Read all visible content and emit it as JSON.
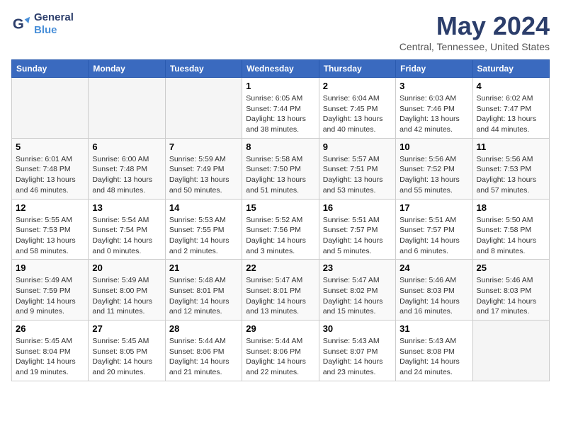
{
  "logo": {
    "line1": "General",
    "line2": "Blue"
  },
  "title": "May 2024",
  "location": "Central, Tennessee, United States",
  "weekdays": [
    "Sunday",
    "Monday",
    "Tuesday",
    "Wednesday",
    "Thursday",
    "Friday",
    "Saturday"
  ],
  "weeks": [
    [
      {
        "day": "",
        "sunrise": "",
        "sunset": "",
        "daylight": ""
      },
      {
        "day": "",
        "sunrise": "",
        "sunset": "",
        "daylight": ""
      },
      {
        "day": "",
        "sunrise": "",
        "sunset": "",
        "daylight": ""
      },
      {
        "day": "1",
        "sunrise": "Sunrise: 6:05 AM",
        "sunset": "Sunset: 7:44 PM",
        "daylight": "Daylight: 13 hours and 38 minutes."
      },
      {
        "day": "2",
        "sunrise": "Sunrise: 6:04 AM",
        "sunset": "Sunset: 7:45 PM",
        "daylight": "Daylight: 13 hours and 40 minutes."
      },
      {
        "day": "3",
        "sunrise": "Sunrise: 6:03 AM",
        "sunset": "Sunset: 7:46 PM",
        "daylight": "Daylight: 13 hours and 42 minutes."
      },
      {
        "day": "4",
        "sunrise": "Sunrise: 6:02 AM",
        "sunset": "Sunset: 7:47 PM",
        "daylight": "Daylight: 13 hours and 44 minutes."
      }
    ],
    [
      {
        "day": "5",
        "sunrise": "Sunrise: 6:01 AM",
        "sunset": "Sunset: 7:48 PM",
        "daylight": "Daylight: 13 hours and 46 minutes."
      },
      {
        "day": "6",
        "sunrise": "Sunrise: 6:00 AM",
        "sunset": "Sunset: 7:48 PM",
        "daylight": "Daylight: 13 hours and 48 minutes."
      },
      {
        "day": "7",
        "sunrise": "Sunrise: 5:59 AM",
        "sunset": "Sunset: 7:49 PM",
        "daylight": "Daylight: 13 hours and 50 minutes."
      },
      {
        "day": "8",
        "sunrise": "Sunrise: 5:58 AM",
        "sunset": "Sunset: 7:50 PM",
        "daylight": "Daylight: 13 hours and 51 minutes."
      },
      {
        "day": "9",
        "sunrise": "Sunrise: 5:57 AM",
        "sunset": "Sunset: 7:51 PM",
        "daylight": "Daylight: 13 hours and 53 minutes."
      },
      {
        "day": "10",
        "sunrise": "Sunrise: 5:56 AM",
        "sunset": "Sunset: 7:52 PM",
        "daylight": "Daylight: 13 hours and 55 minutes."
      },
      {
        "day": "11",
        "sunrise": "Sunrise: 5:56 AM",
        "sunset": "Sunset: 7:53 PM",
        "daylight": "Daylight: 13 hours and 57 minutes."
      }
    ],
    [
      {
        "day": "12",
        "sunrise": "Sunrise: 5:55 AM",
        "sunset": "Sunset: 7:53 PM",
        "daylight": "Daylight: 13 hours and 58 minutes."
      },
      {
        "day": "13",
        "sunrise": "Sunrise: 5:54 AM",
        "sunset": "Sunset: 7:54 PM",
        "daylight": "Daylight: 14 hours and 0 minutes."
      },
      {
        "day": "14",
        "sunrise": "Sunrise: 5:53 AM",
        "sunset": "Sunset: 7:55 PM",
        "daylight": "Daylight: 14 hours and 2 minutes."
      },
      {
        "day": "15",
        "sunrise": "Sunrise: 5:52 AM",
        "sunset": "Sunset: 7:56 PM",
        "daylight": "Daylight: 14 hours and 3 minutes."
      },
      {
        "day": "16",
        "sunrise": "Sunrise: 5:51 AM",
        "sunset": "Sunset: 7:57 PM",
        "daylight": "Daylight: 14 hours and 5 minutes."
      },
      {
        "day": "17",
        "sunrise": "Sunrise: 5:51 AM",
        "sunset": "Sunset: 7:57 PM",
        "daylight": "Daylight: 14 hours and 6 minutes."
      },
      {
        "day": "18",
        "sunrise": "Sunrise: 5:50 AM",
        "sunset": "Sunset: 7:58 PM",
        "daylight": "Daylight: 14 hours and 8 minutes."
      }
    ],
    [
      {
        "day": "19",
        "sunrise": "Sunrise: 5:49 AM",
        "sunset": "Sunset: 7:59 PM",
        "daylight": "Daylight: 14 hours and 9 minutes."
      },
      {
        "day": "20",
        "sunrise": "Sunrise: 5:49 AM",
        "sunset": "Sunset: 8:00 PM",
        "daylight": "Daylight: 14 hours and 11 minutes."
      },
      {
        "day": "21",
        "sunrise": "Sunrise: 5:48 AM",
        "sunset": "Sunset: 8:01 PM",
        "daylight": "Daylight: 14 hours and 12 minutes."
      },
      {
        "day": "22",
        "sunrise": "Sunrise: 5:47 AM",
        "sunset": "Sunset: 8:01 PM",
        "daylight": "Daylight: 14 hours and 13 minutes."
      },
      {
        "day": "23",
        "sunrise": "Sunrise: 5:47 AM",
        "sunset": "Sunset: 8:02 PM",
        "daylight": "Daylight: 14 hours and 15 minutes."
      },
      {
        "day": "24",
        "sunrise": "Sunrise: 5:46 AM",
        "sunset": "Sunset: 8:03 PM",
        "daylight": "Daylight: 14 hours and 16 minutes."
      },
      {
        "day": "25",
        "sunrise": "Sunrise: 5:46 AM",
        "sunset": "Sunset: 8:03 PM",
        "daylight": "Daylight: 14 hours and 17 minutes."
      }
    ],
    [
      {
        "day": "26",
        "sunrise": "Sunrise: 5:45 AM",
        "sunset": "Sunset: 8:04 PM",
        "daylight": "Daylight: 14 hours and 19 minutes."
      },
      {
        "day": "27",
        "sunrise": "Sunrise: 5:45 AM",
        "sunset": "Sunset: 8:05 PM",
        "daylight": "Daylight: 14 hours and 20 minutes."
      },
      {
        "day": "28",
        "sunrise": "Sunrise: 5:44 AM",
        "sunset": "Sunset: 8:06 PM",
        "daylight": "Daylight: 14 hours and 21 minutes."
      },
      {
        "day": "29",
        "sunrise": "Sunrise: 5:44 AM",
        "sunset": "Sunset: 8:06 PM",
        "daylight": "Daylight: 14 hours and 22 minutes."
      },
      {
        "day": "30",
        "sunrise": "Sunrise: 5:43 AM",
        "sunset": "Sunset: 8:07 PM",
        "daylight": "Daylight: 14 hours and 23 minutes."
      },
      {
        "day": "31",
        "sunrise": "Sunrise: 5:43 AM",
        "sunset": "Sunset: 8:08 PM",
        "daylight": "Daylight: 14 hours and 24 minutes."
      },
      {
        "day": "",
        "sunrise": "",
        "sunset": "",
        "daylight": ""
      }
    ]
  ]
}
